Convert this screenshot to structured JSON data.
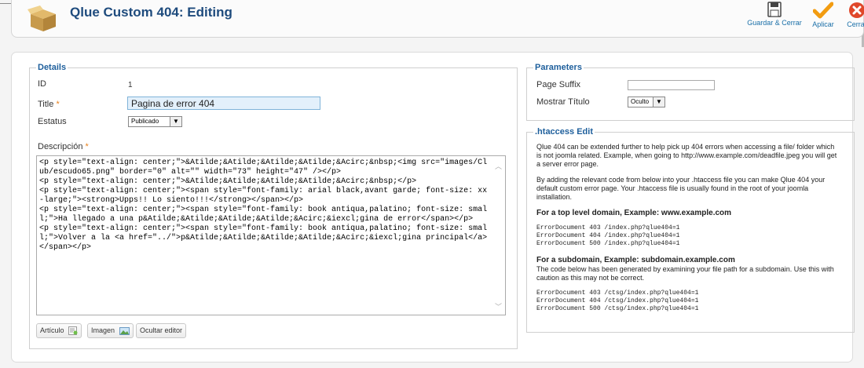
{
  "header": {
    "title": "Qlue Custom 404: Editing",
    "icon": "box-icon"
  },
  "toolbar": {
    "save_close_label": "Guardar & Cerrar",
    "apply_label": "Aplicar",
    "close_label": "Cerrar"
  },
  "details": {
    "legend": "Details",
    "id_label": "ID",
    "id_value": "1",
    "title_label": "Title",
    "title_value": "Pagina de error 404",
    "required_mark": "*",
    "status_label": "Estatus",
    "status_value": "Publicado",
    "description_label": "Descripción",
    "description_html": "<p style=\"text-align: center;\">&Atilde;&Atilde;&Atilde;&Atilde;&Acirc;&nbsp;<img src=\"images/Club/escudo65.png\" border=\"0\" alt=\"\" width=\"73\" height=\"47\" /></p>\n<p style=\"text-align: center;\">&Atilde;&Atilde;&Atilde;&Atilde;&Acirc;&nbsp;</p>\n<p style=\"text-align: center;\"><span style=\"font-family: arial black,avant garde; font-size: xx-large;\"><strong>Upps!! Lo siento!!!</strong></span></p>\n<p style=\"text-align: center;\"><span style=\"font-family: book antiqua,palatino; font-size: small;\">Ha llegado a una p&Atilde;&Atilde;&Atilde;&Atilde;&Acirc;&iexcl;gina de error</span></p>\n<p style=\"text-align: center;\"><span style=\"font-family: book antiqua,palatino; font-size: small;\">Volver a la <a href=\"../\">p&Atilde;&Atilde;&Atilde;&Atilde;&Acirc;&iexcl;gina principal</a></span></p>",
    "buttons": {
      "article": "Artículo",
      "image": "Imagen",
      "toggle_editor": "Ocultar editor"
    }
  },
  "parameters": {
    "legend": "Parameters",
    "page_suffix_label": "Page Suffix",
    "page_suffix_value": "",
    "show_title_label": "Mostrar Título",
    "show_title_value": "Oculto"
  },
  "htaccess": {
    "legend": ".htaccess Edit",
    "intro": "Qlue 404 can be extended further to help pick up 404 errors when accessing a file/ folder which is not joomla related. Example, when going to http://www.example.com/deadfile.jpeg you will get a server error page.",
    "instructions": "By adding the relevant code from below into your .htaccess file you can make Qlue 404 your default custom error page. Your .htaccess file is usually found in the root of your joomla installation.",
    "top_level_heading": "For a top level domain, Example: www.example.com",
    "top_level_code": "ErrorDocument 403 /index.php?qlue404=1\nErrorDocument 404 /index.php?qlue404=1\nErrorDocument 500 /index.php?qlue404=1",
    "subdomain_heading": "For a subdomain, Example: subdomain.example.com",
    "subdomain_note": "The code below has been generated by examining your file path for a subdomain. Use this with caution as this may not be correct.",
    "subdomain_code": "ErrorDocument 403 /ctsg/index.php?qlue404=1\nErrorDocument 404 /ctsg/index.php?qlue404=1\nErrorDocument 500 /ctsg/index.php?qlue404=1"
  },
  "colors": {
    "title": "#1e4b7d",
    "legend": "#1e5f9c",
    "link": "#1a6fa8",
    "required": "#e8801c",
    "apply_check": "#f29c11",
    "close_red": "#e0472a"
  }
}
